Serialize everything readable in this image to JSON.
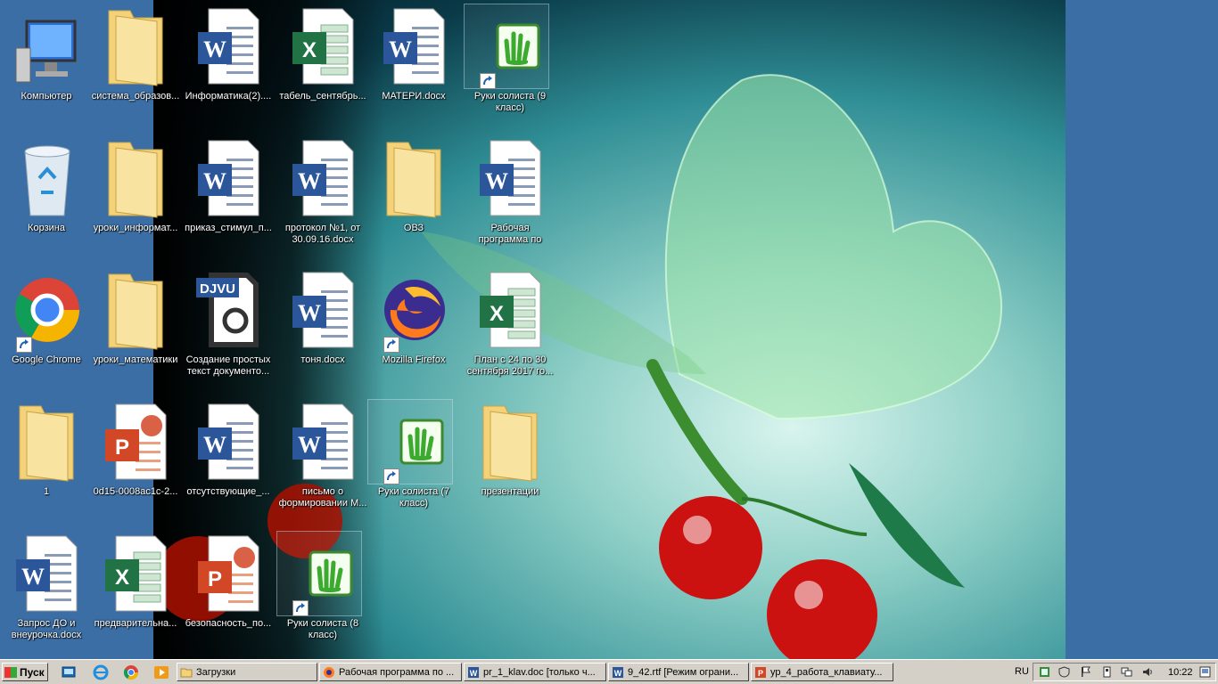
{
  "desktop": {
    "icons": [
      {
        "label": "Компьютер",
        "type": "computer"
      },
      {
        "label": "система_образов...",
        "type": "folder"
      },
      {
        "label": "Информатика(2)....",
        "type": "word"
      },
      {
        "label": "табель_сентябрь...",
        "type": "excel"
      },
      {
        "label": "МАТЕРИ.docx",
        "type": "word"
      },
      {
        "label": "Руки солиста (9 класс)",
        "type": "app-hand"
      },
      {
        "label": "Корзина",
        "type": "recycle-bin"
      },
      {
        "label": "уроки_информат...",
        "type": "folder"
      },
      {
        "label": "приказ_стимул_п...",
        "type": "word"
      },
      {
        "label": "протокол №1, от 30.09.16.docx",
        "type": "word"
      },
      {
        "label": "ОВЗ",
        "type": "folder"
      },
      {
        "label": "Рабочая программа по информатике ...",
        "type": "word"
      },
      {
        "label": "Google Chrome",
        "type": "chrome"
      },
      {
        "label": "уроки_математики",
        "type": "folder"
      },
      {
        "label": "Создание простых текст документо...",
        "type": "djvu"
      },
      {
        "label": "тоня.docx",
        "type": "word"
      },
      {
        "label": "Mozilla Firefox",
        "type": "firefox"
      },
      {
        "label": "План с 24 по 30 сентября 2017 го...",
        "type": "excel"
      },
      {
        "label": "1",
        "type": "folder"
      },
      {
        "label": "0d15-0008ac1c-2...",
        "type": "powerpoint"
      },
      {
        "label": "отсутствующие_...",
        "type": "word"
      },
      {
        "label": "письмо о формировании М...",
        "type": "word"
      },
      {
        "label": "Руки солиста (7 класс)",
        "type": "app-hand"
      },
      {
        "label": "презентации",
        "type": "folder"
      },
      {
        "label": "Запрос ДО и внеурочка.docx",
        "type": "word"
      },
      {
        "label": "предварительна...",
        "type": "excel"
      },
      {
        "label": "безопасность_по...",
        "type": "powerpoint"
      },
      {
        "label": "Руки солиста (8 класс)",
        "type": "app-hand"
      }
    ],
    "djvu_badge": "DJVU"
  },
  "taskbar": {
    "start_label": "Пуск",
    "tasks": [
      {
        "label": "Загрузки"
      },
      {
        "label": "Рабочая программа по ..."
      },
      {
        "label": "pr_1_klav.doc [только ч..."
      },
      {
        "label": "9_42.rtf [Режим ограни..."
      },
      {
        "label": "ур_4_работа_клавиату..."
      }
    ],
    "language": "RU",
    "clock": "10:22"
  },
  "colors": {
    "desktop_bg": "#3a6ea5",
    "taskbar_bg": "#d4d0c8",
    "word_blue": "#2b579a",
    "excel_green": "#217346",
    "ppt_red": "#d24726",
    "folder_yellow": "#f3d27a"
  }
}
